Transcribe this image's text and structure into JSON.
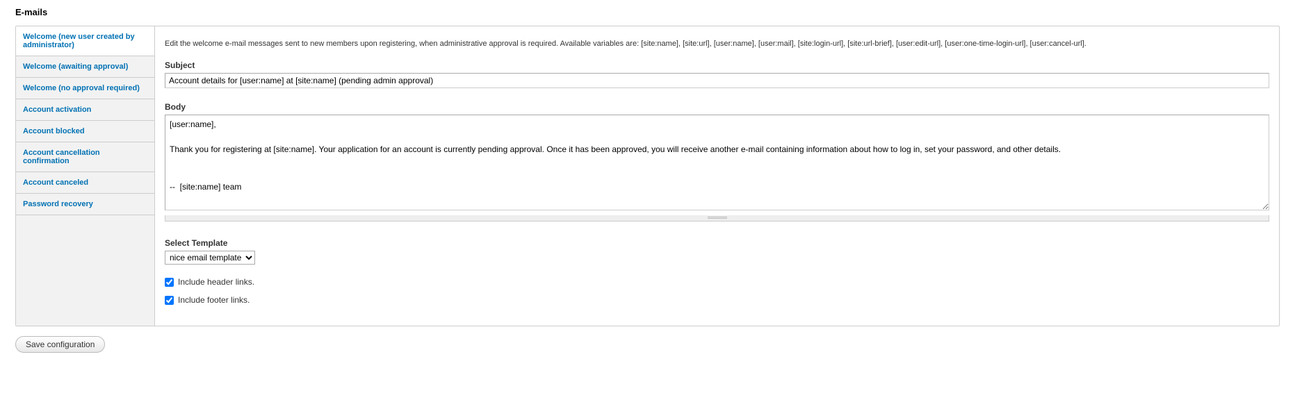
{
  "page_title": "E-mails",
  "tabs": [
    {
      "label": "Welcome (new user created by administrator)"
    },
    {
      "label": "Welcome (awaiting approval)"
    },
    {
      "label": "Welcome (no approval required)"
    },
    {
      "label": "Account activation"
    },
    {
      "label": "Account blocked"
    },
    {
      "label": "Account cancellation confirmation"
    },
    {
      "label": "Account canceled"
    },
    {
      "label": "Password recovery"
    }
  ],
  "content": {
    "description": "Edit the welcome e-mail messages sent to new members upon registering, when administrative approval is required. Available variables are: [site:name], [site:url], [user:name], [user:mail], [site:login-url], [site:url-brief], [user:edit-url], [user:one-time-login-url], [user:cancel-url].",
    "subject_label": "Subject",
    "subject_value": "Account details for [user:name] at [site:name] (pending admin approval)",
    "body_label": "Body",
    "body_value": "[user:name],\n\nThank you for registering at [site:name]. Your application for an account is currently pending approval. Once it has been approved, you will receive another e-mail containing information about how to log in, set your password, and other details.\n\n\n--  [site:name] team",
    "select_template_label": "Select Template",
    "select_template_value": "nice email template",
    "include_header_label": "Include header links.",
    "include_footer_label": "Include footer links."
  },
  "save_button_label": "Save configuration"
}
